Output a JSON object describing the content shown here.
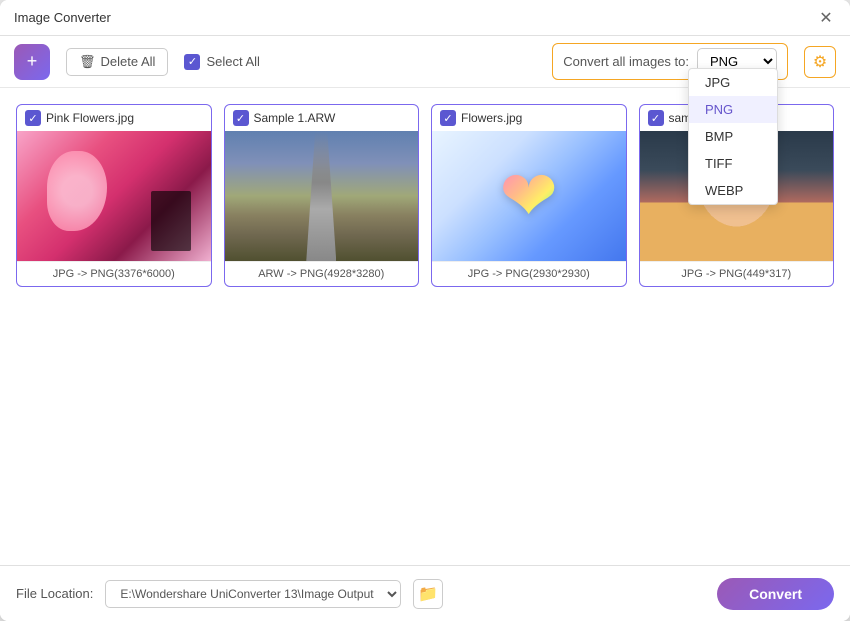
{
  "window": {
    "title": "Image Converter"
  },
  "toolbar": {
    "delete_all_label": "Delete All",
    "select_all_label": "Select All",
    "convert_all_label": "Convert all images to:",
    "selected_format": "PNG",
    "formats": [
      "JPG",
      "PNG",
      "BMP",
      "TIFF",
      "WEBP"
    ]
  },
  "images": [
    {
      "filename": "Pink Flowers.jpg",
      "info": "JPG -> PNG(3376*6000)",
      "type": "flowers"
    },
    {
      "filename": "Sample 1.ARW",
      "info": "ARW -> PNG(4928*3280)",
      "type": "road"
    },
    {
      "filename": "Flowers.jpg",
      "info": "JPG -> PNG(2930*2930)",
      "type": "flower-heart"
    },
    {
      "filename": "sample i...",
      "info": "JPG -> PNG(449*317)",
      "type": "person"
    }
  ],
  "footer": {
    "file_location_label": "File Location:",
    "file_path": "E:\\Wondershare UniConverter 13\\Image Output",
    "convert_button_label": "Convert"
  },
  "dropdown": {
    "items": [
      {
        "label": "JPG",
        "active": false
      },
      {
        "label": "PNG",
        "active": true
      },
      {
        "label": "BMP",
        "active": false
      },
      {
        "label": "TIFF",
        "active": false
      },
      {
        "label": "WEBP",
        "active": false
      }
    ]
  },
  "icons": {
    "close": "✕",
    "delete": "🗑",
    "settings": "⚙",
    "folder": "📁"
  }
}
